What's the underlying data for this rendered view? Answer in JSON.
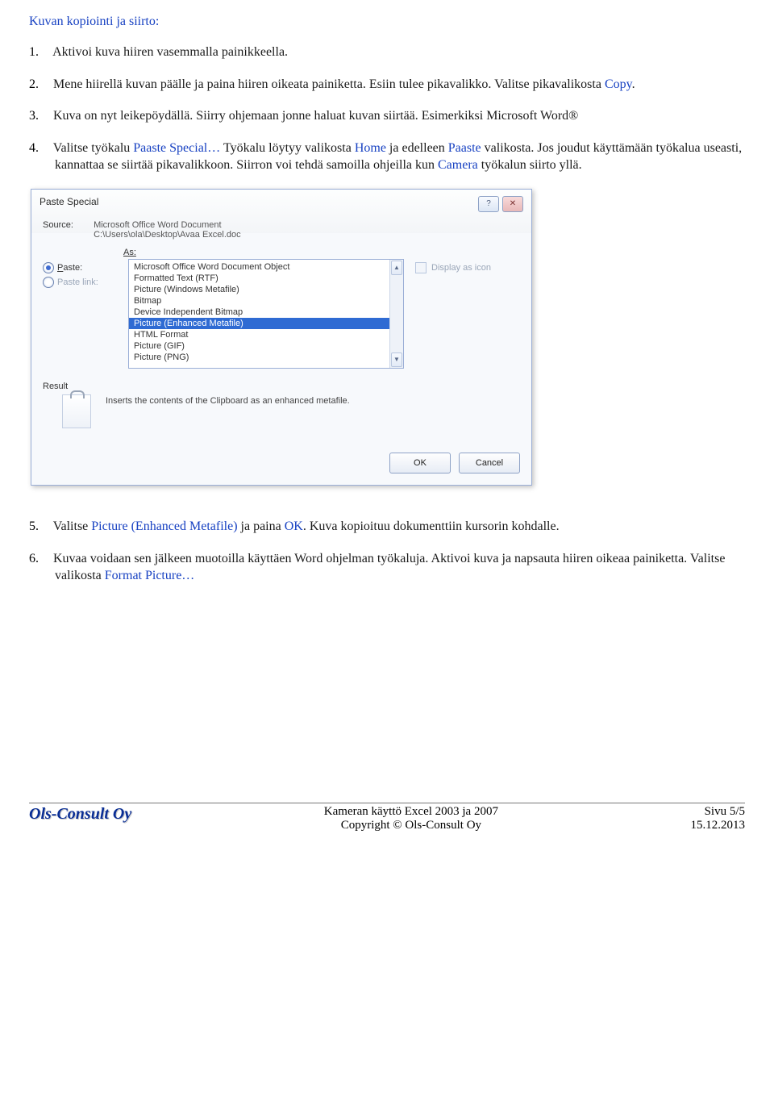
{
  "heading": "Kuvan kopiointi ja siirto:",
  "steps": {
    "s1": {
      "num": "1.",
      "t1": "Aktivoi kuva hiiren vasemmalla painikkeella."
    },
    "s2": {
      "num": "2.",
      "t1": "Mene hiirellä kuvan päälle ja paina hiiren oikeata painiketta. Esiin tulee pikavalikko. Valitse pikavalikosta ",
      "sp1": "Copy",
      "t2": "."
    },
    "s3": {
      "num": "3.",
      "t1": "Kuva on nyt leikepöydällä. Siirry ohjemaan jonne haluat kuvan siirtää. Esimerkiksi Microsoft Word®"
    },
    "s4": {
      "num": "4.",
      "t1": "Valitse työkalu ",
      "sp1": "Paaste Special…",
      "t2": " Työkalu löytyy valikosta ",
      "sp2": "Home",
      "t3": " ja edelleen ",
      "sp3": "Paaste",
      "t4": " valikosta. Jos joudut käyttämään työkalua useasti, kannattaa se siirtää pikavalikkoon. Siirron voi tehdä samoilla ohjeilla kun ",
      "sp4": "Camera",
      "t5": " työkalun siirto yllä."
    },
    "s5": {
      "num": "5.",
      "t1": "Valitse ",
      "sp1": "Picture (Enhanced Metafile)",
      "t2": " ja paina ",
      "sp2": "OK",
      "t3": ". Kuva kopioituu dokumenttiin kursorin kohdalle."
    },
    "s6": {
      "num": "6.",
      "t1": "Kuvaa voidaan sen jälkeen muotoilla käyttäen Word ohjelman työkaluja. Aktivoi kuva ja napsauta hiiren oikeaa painiketta. Valitse valikosta ",
      "sp1": "Format Picture…"
    }
  },
  "dialog": {
    "title": "Paste Special",
    "help": "?",
    "close": "✕",
    "source_label": "Source:",
    "source_line1": "Microsoft Office Word Document",
    "source_line2": "C:\\Users\\ola\\Desktop\\Avaa Excel.doc",
    "as_label": "As:",
    "paste_label": "Paste:",
    "pastelink_label": "Paste link:",
    "display_icon": "Display as icon",
    "items": {
      "i0": "Microsoft Office Word Document Object",
      "i1": "Formatted Text (RTF)",
      "i2": "Picture (Windows Metafile)",
      "i3": "Bitmap",
      "i4": "Device Independent Bitmap",
      "i5": "Picture (Enhanced Metafile)",
      "i6": "HTML Format",
      "i7": "Picture (GIF)",
      "i8": "Picture (PNG)"
    },
    "result_label": "Result",
    "result_desc": "Inserts the contents of the Clipboard as an enhanced metafile.",
    "ok": "OK",
    "cancel": "Cancel",
    "arrow_up": "▲",
    "arrow_dn": "▼"
  },
  "footer": {
    "logo": "Ols-Consult Oy",
    "center1": "Kameran käyttö Excel 2003 ja 2007",
    "center2": "Copyright © Ols-Consult Oy",
    "right1": "Sivu 5/5",
    "right2": "15.12.2013"
  }
}
